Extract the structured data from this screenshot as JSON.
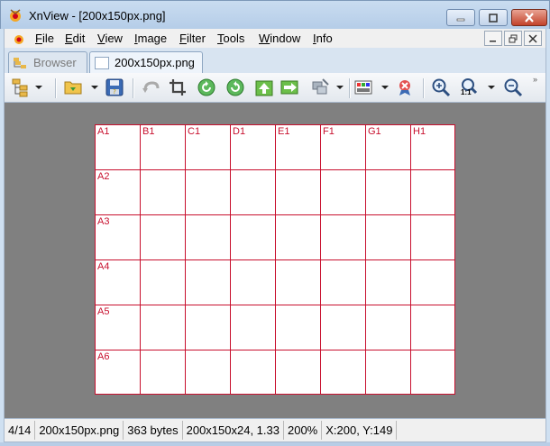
{
  "window": {
    "title": "XnView - [200x150px.png]",
    "app_icon": "xnview-logo-icon",
    "controls": [
      "minimize-icon",
      "maximize-icon",
      "close-icon"
    ]
  },
  "menu": {
    "items": [
      "File",
      "Edit",
      "View",
      "Image",
      "Filter",
      "Tools",
      "Window",
      "Info"
    ],
    "mdi_controls": [
      "mdi-minimize-icon",
      "mdi-restore-icon",
      "mdi-close-icon"
    ]
  },
  "tabs": [
    {
      "label": "Browser",
      "active": false,
      "icon": "browser-folder-icon"
    },
    {
      "label": "200x150px.png",
      "active": true,
      "icon": "image-file-icon"
    }
  ],
  "toolbar": {
    "buttons": [
      "folder-tree-icon",
      "open-folder-icon",
      "save-icon",
      "undo-icon",
      "crop-icon",
      "rotate-left-icon",
      "rotate-right-icon",
      "previous-image-icon",
      "next-image-icon",
      "tools-icon",
      "color-adjust-icon",
      "close-image-icon",
      "zoom-in-icon",
      "zoom-actual-icon",
      "zoom-out-icon"
    ],
    "zoom_actual_label": "1:1",
    "more": "»"
  },
  "image": {
    "columns": [
      "A",
      "B",
      "C",
      "D",
      "E",
      "F",
      "G",
      "H"
    ],
    "rows": [
      "1",
      "2",
      "3",
      "4",
      "5",
      "6"
    ],
    "first_row_labels": [
      "A1",
      "B1",
      "C1",
      "D1",
      "E1",
      "F1",
      "G1",
      "H1"
    ],
    "first_column_labels": [
      "A2",
      "A3",
      "A4",
      "A5",
      "A6"
    ],
    "grid_color": "#c8102e",
    "background": "#808080"
  },
  "status": {
    "index": "4/14",
    "filename": "200x150px.png",
    "filesize": "363 bytes",
    "dimensions": "200x150x24, 1.33",
    "zoom": "200%",
    "cursor": "X:200, Y:149"
  }
}
